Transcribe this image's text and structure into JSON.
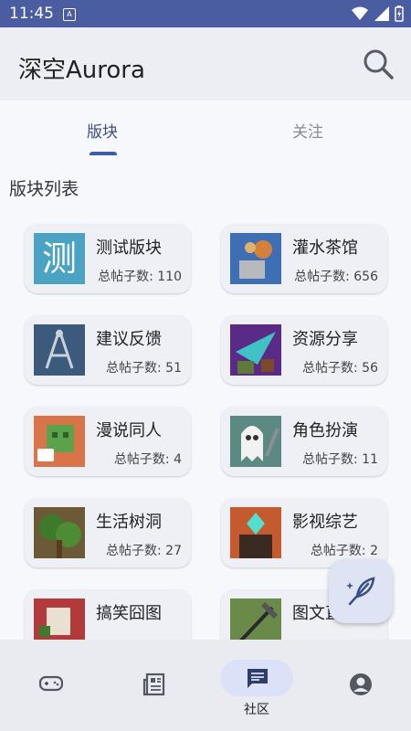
{
  "status_bar": {
    "time": "11:45",
    "notif_letter": "A"
  },
  "app_bar": {
    "title": "深空Aurora",
    "search_icon": "search-icon"
  },
  "tabs": [
    {
      "label": "版块",
      "active": true
    },
    {
      "label": "关注",
      "active": false
    }
  ],
  "section_title": "版块列表",
  "boards": [
    {
      "name": "测试版块",
      "count": "总帖子数: 110",
      "icon": "test-board-thumbnail"
    },
    {
      "name": "灌水茶馆",
      "count": "总帖子数: 656",
      "icon": "teahouse-thumbnail"
    },
    {
      "name": "建议反馈",
      "count": "总帖子数: 51",
      "icon": "feedback-thumbnail"
    },
    {
      "name": "资源分享",
      "count": "总帖子数: 56",
      "icon": "resources-thumbnail"
    },
    {
      "name": "漫说同人",
      "count": "总帖子数: 4",
      "icon": "fanwork-thumbnail"
    },
    {
      "name": "角色扮演",
      "count": "总帖子数: 11",
      "icon": "roleplay-thumbnail"
    },
    {
      "name": "生活树洞",
      "count": "总帖子数: 27",
      "icon": "life-thumbnail"
    },
    {
      "name": "影视综艺",
      "count": "总帖子数: 2",
      "icon": "media-thumbnail"
    },
    {
      "name": "搞笑囧图",
      "count": "",
      "icon": "funny-thumbnail"
    },
    {
      "name": "图文直",
      "count": "",
      "icon": "picture-thumbnail"
    }
  ],
  "bottom_nav": [
    {
      "label": "",
      "icon": "gamepad-icon",
      "active": false
    },
    {
      "label": "",
      "icon": "news-icon",
      "active": false
    },
    {
      "label": "社区",
      "icon": "forum-icon",
      "active": true
    },
    {
      "label": "",
      "icon": "account-icon",
      "active": false
    }
  ],
  "fab": {
    "icon": "feather-pen-icon"
  },
  "colors": {
    "status_bar": "#4a5da0",
    "accent": "#3a5fa8",
    "nav_pill": "#dbe1f7"
  }
}
